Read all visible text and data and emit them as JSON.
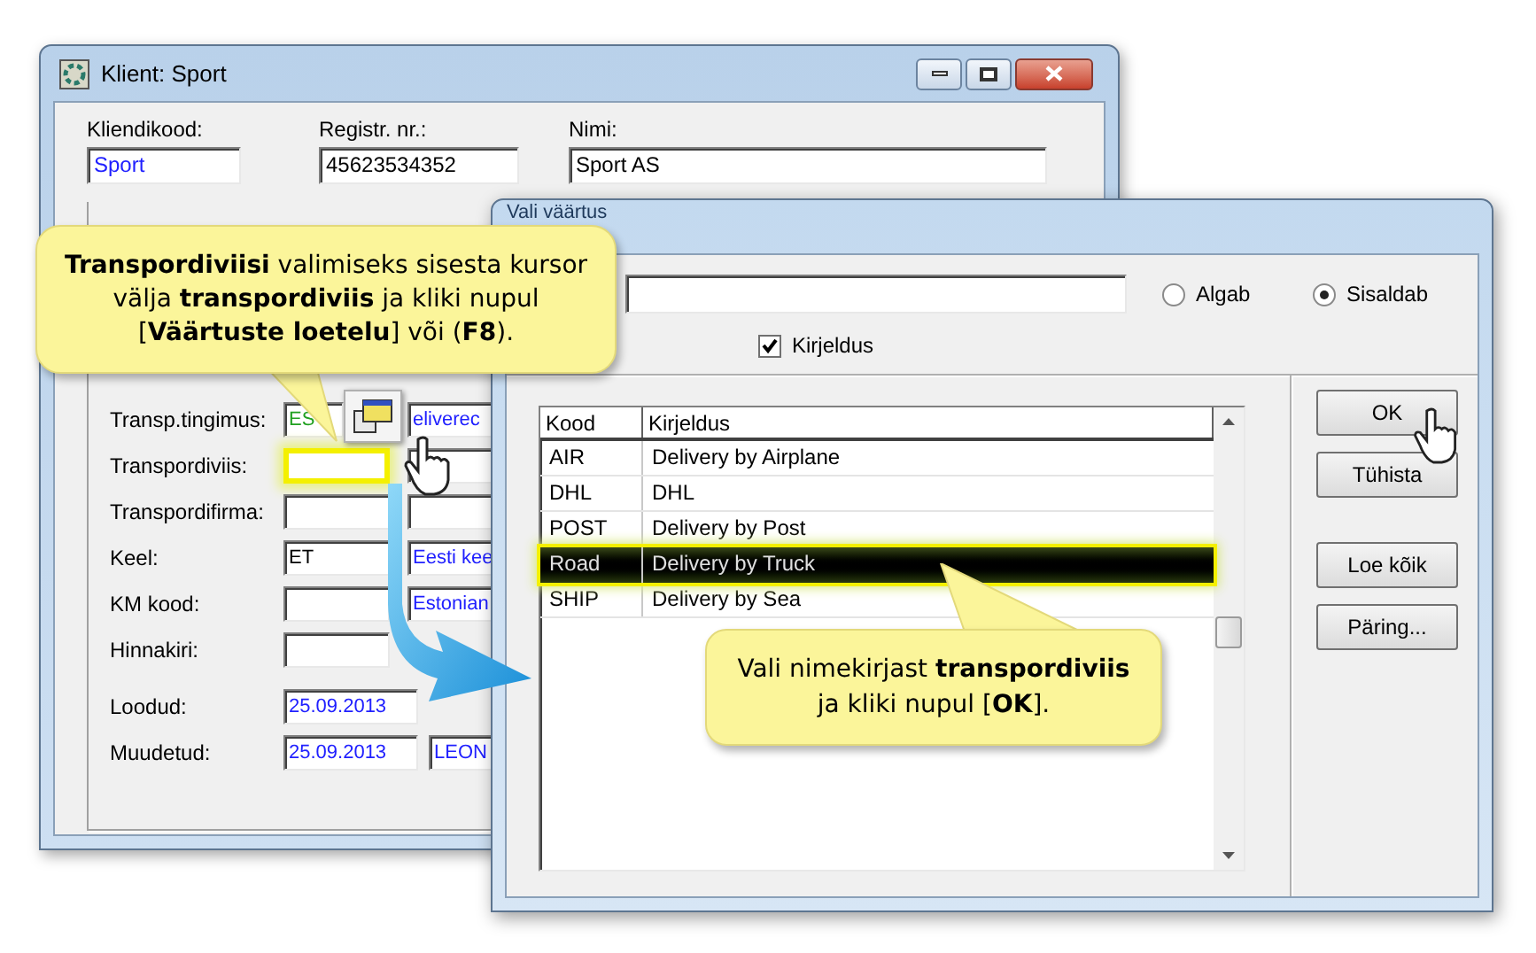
{
  "client_window": {
    "title": "Klient: Sport",
    "header_fields": [
      {
        "label": "Kliendikood:",
        "value": "Sport",
        "color": "#2020ff"
      },
      {
        "label": "Registr. nr.:",
        "value": "45623534352",
        "color": "#000000"
      },
      {
        "label": "Nimi:",
        "value": "Sport AS",
        "color": "#000000"
      }
    ],
    "rows": [
      {
        "label": "Transp.tingimus:",
        "highlighted": false,
        "fields": [
          {
            "kind": "short",
            "value": "ES",
            "color": "#20a020"
          },
          {
            "kind": "name",
            "value": "eliverec",
            "color": "#2020ff"
          }
        ]
      },
      {
        "label": "Transpordiviis:",
        "highlighted": true,
        "fields": [
          {
            "kind": "code"
          },
          {
            "kind": "name"
          }
        ]
      },
      {
        "label": "Transpordifirma:",
        "highlighted": false,
        "fields": [
          {
            "kind": "code"
          },
          {
            "kind": "name"
          }
        ]
      },
      {
        "label": "Keel:",
        "highlighted": false,
        "fields": [
          {
            "kind": "code",
            "value": "ET",
            "color": "#000000"
          },
          {
            "kind": "name",
            "value": "Eesti kee",
            "color": "#2020ff"
          }
        ]
      },
      {
        "label": "KM kood:",
        "highlighted": false,
        "fields": [
          {
            "kind": "code"
          },
          {
            "kind": "name",
            "value": "Estonian",
            "color": "#2020ff"
          }
        ]
      },
      {
        "label": "Hinnakiri:",
        "highlighted": false,
        "fields": [
          {
            "kind": "wide"
          }
        ]
      },
      {
        "label": "Loodud:",
        "highlighted": false,
        "fields": [
          {
            "kind": "date",
            "value": "25.09.2013",
            "color": "#2020ff"
          }
        ]
      },
      {
        "label": "Muudetud:",
        "highlighted": false,
        "fields": [
          {
            "kind": "date",
            "value": "25.09.2013",
            "color": "#2020ff"
          },
          {
            "kind": "user",
            "value": "LEON",
            "color": "#2020ff"
          }
        ]
      }
    ]
  },
  "dialog": {
    "title": "Vali väärtus",
    "radios": [
      {
        "label": "Algab",
        "selected": false
      },
      {
        "label": "Sisaldab",
        "selected": true
      }
    ],
    "checkbox": {
      "label": "Kirjeldus",
      "checked": true
    },
    "table": {
      "columns": [
        "Kood",
        "Kirjeldus"
      ],
      "rows": [
        {
          "cells": [
            "AIR",
            "Delivery by Airplane"
          ],
          "selected": false
        },
        {
          "cells": [
            "DHL",
            "DHL"
          ],
          "selected": false
        },
        {
          "cells": [
            "POST",
            "Delivery by Post"
          ],
          "selected": false
        },
        {
          "cells": [
            "Road",
            "Delivery by Truck"
          ],
          "selected": true
        },
        {
          "cells": [
            "SHIP",
            "Delivery by Sea"
          ],
          "selected": false
        }
      ]
    },
    "buttons": [
      "OK",
      "Tühista",
      "Loe kõik",
      "Päring..."
    ]
  },
  "callouts": [
    {
      "text": "**Transpordiviisi**  valimiseks sisesta kursor välja **transpordiviis** ja kliki nupul [**Väärtuste loetelu**] või (**F8**)."
    },
    {
      "text": "Vali nimekirjast **transpordiviis** ja kliki nupul [**OK**]."
    }
  ]
}
